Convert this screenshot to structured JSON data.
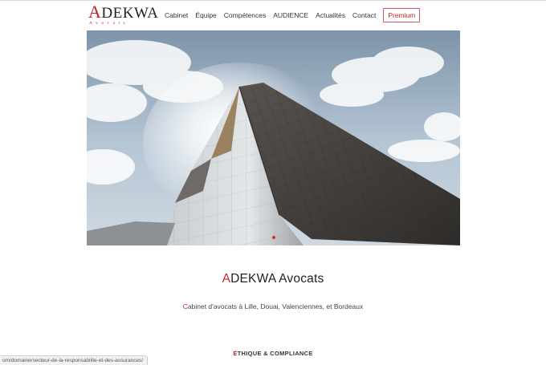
{
  "header": {
    "logo": {
      "first_letter": "A",
      "rest": "DEKWA",
      "subtitle": "Avocats"
    },
    "nav": [
      {
        "label": "Cabinet"
      },
      {
        "label": "Équipe"
      },
      {
        "label": "Compétences"
      },
      {
        "label": "AUDIENCE"
      },
      {
        "label": "Actualités"
      },
      {
        "label": "Contact"
      },
      {
        "label": "Premium"
      }
    ]
  },
  "hero": {
    "image_description": "photo-modern-architecture-building",
    "active_slide_indicator": 1
  },
  "intro": {
    "title_first": "A",
    "title_rest": "DEKWA Avocats",
    "tagline_first": "C",
    "tagline_rest": "abinet d'avocats à Lille, Douai, Valenciennes, et Bordeaux"
  },
  "section": {
    "heading_first": "É",
    "heading_rest": "THIQUE & COMPLIANCE"
  },
  "status_bar": {
    "url": "om/domaine/secteur-de-la-responsabilite-et-des-assurances/"
  },
  "colors": {
    "accent": "#c0272d",
    "text": "#333333"
  }
}
